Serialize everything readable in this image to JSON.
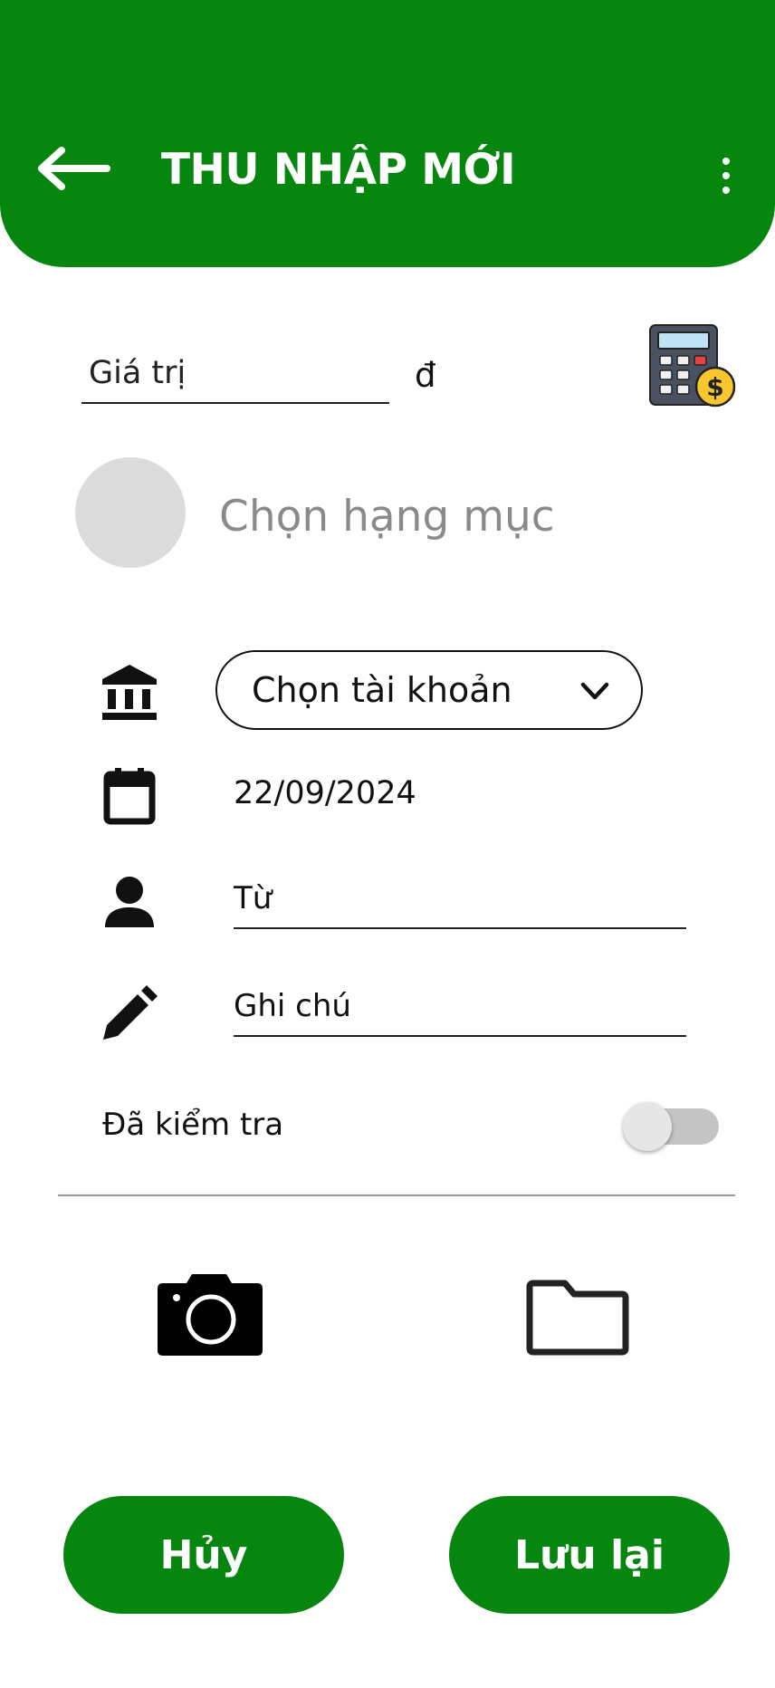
{
  "header": {
    "title": "THU NHẬP MỚI",
    "back_icon": "arrow-left-icon",
    "menu_icon": "more-vertical-icon",
    "background_color": "#06860f"
  },
  "amount": {
    "placeholder": "Giá trị",
    "currency": "đ",
    "calculator_icon": "calculator-icon"
  },
  "category": {
    "label": "Chọn hạng mục"
  },
  "account": {
    "icon": "bank-icon",
    "label": "Chọn tài khoản",
    "dropdown_icon": "chevron-down-icon"
  },
  "date": {
    "icon": "calendar-icon",
    "value": "22/09/2024"
  },
  "from": {
    "icon": "person-icon",
    "placeholder": "Từ"
  },
  "note": {
    "icon": "pencil-icon",
    "placeholder": "Ghi chú"
  },
  "checked": {
    "label": "Đã kiểm tra",
    "enabled": false
  },
  "attachments": {
    "camera_icon": "camera-icon",
    "folder_icon": "folder-icon"
  },
  "actions": {
    "cancel_label": "Hủy",
    "save_label": "Lưu lại"
  }
}
